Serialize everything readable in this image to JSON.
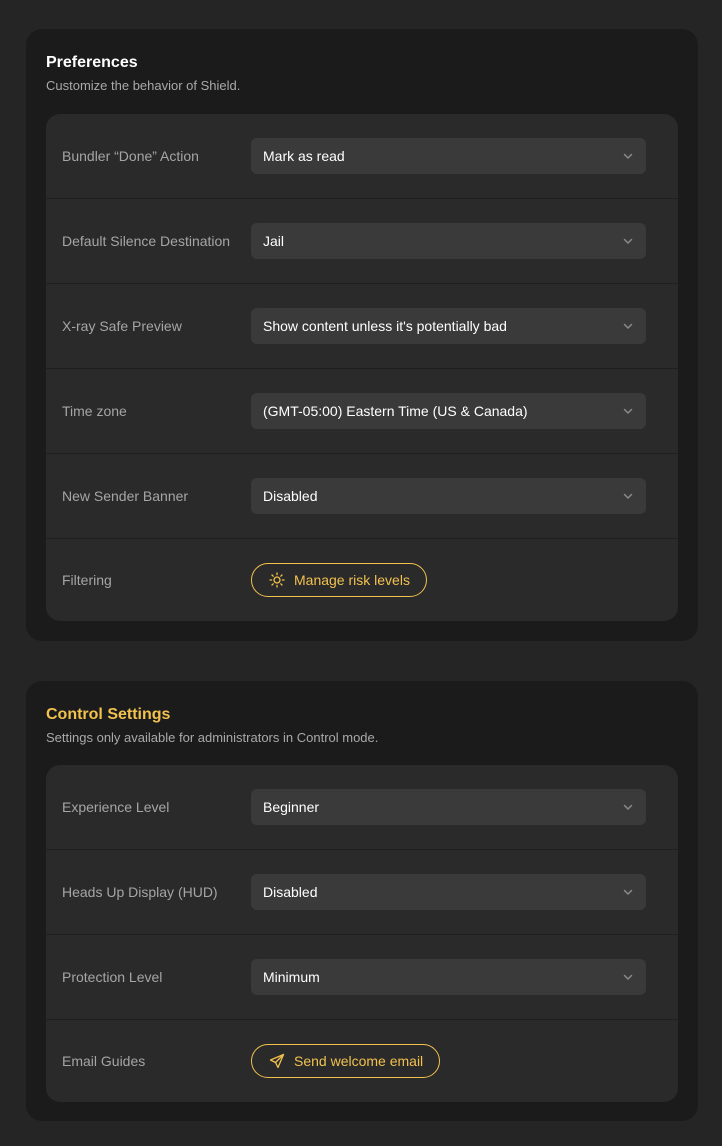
{
  "preferences": {
    "title": "Preferences",
    "subtitle": "Customize the behavior of Shield.",
    "rows": [
      {
        "label": "Bundler “Done” Action",
        "value": "Mark as read"
      },
      {
        "label": "Default Silence Destination",
        "value": "Jail"
      },
      {
        "label": "X-ray Safe Preview",
        "value": "Show content unless it's potentially bad"
      },
      {
        "label": "Time zone",
        "value": "(GMT-05:00) Eastern Time (US & Canada)"
      },
      {
        "label": "New Sender Banner",
        "value": "Disabled"
      }
    ],
    "filtering": {
      "label": "Filtering",
      "button_label": "Manage risk levels",
      "button_icon": "sun-icon"
    }
  },
  "control_settings": {
    "title": "Control Settings",
    "subtitle": "Settings only available for administrators in Control mode.",
    "rows": [
      {
        "label": "Experience Level",
        "value": "Beginner"
      },
      {
        "label": "Heads Up Display (HUD)",
        "value": "Disabled"
      },
      {
        "label": "Protection Level",
        "value": "Minimum"
      }
    ],
    "email_guides": {
      "label": "Email Guides",
      "button_label": "Send welcome email",
      "button_icon": "paper-plane-icon"
    }
  },
  "colors": {
    "background": "#252525",
    "card": "#1b1b1b",
    "panel": "#2a2a2a",
    "select": "#3a3a3a",
    "accent": "#f2c14e"
  }
}
